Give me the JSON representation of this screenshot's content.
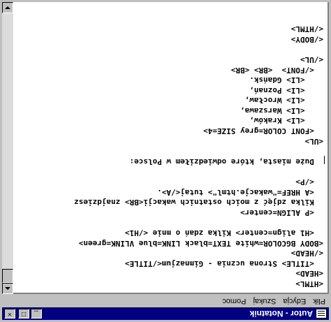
{
  "window": {
    "title": "Autor - Notatnik",
    "minimize_label": "_",
    "maximize_label": "□",
    "close_label": "×"
  },
  "menu": {
    "items": [
      "Plik",
      "Edycja",
      "Szukaj",
      "Pomoc"
    ]
  },
  "editor": {
    "lines": [
      "<HTML>",
      "<HEAD>",
      "  <TITLE> Strona ucznia - Gimnazjum</TITLE>",
      "</HEAD>",
      "<BODY BGCOLOR=white TEXT=black LINK=blue VLINK=green>",
      "  <H1 align=center> Kilka zdań o mnie </H1>",
      "",
      "  <P ALIGN=center>",
      "  Kilka zdjęć z moich ostatnich wakacji<BR> znajdziesz",
      "  <A HREF=\"wakacje.html\"> tutaj</A>.",
      "  </P>",
      "",
      "  Duże miasta, które odwiedziłem w Polsce:",
      "",
      "<UL>",
      "  <FONT COLOR=grey SIZE=4>",
      "    <LI> Kraków,",
      "    <LI> Warszawa,",
      "    <LI> Wrocław,",
      "    <LI> Poznań,",
      "    <LI> Gdańsk.",
      "  </FONT>  <BR> <BR>",
      "</UL>",
      "",
      "</BODY>",
      "</HTML>"
    ]
  },
  "colors": {
    "titlebar": "#000080",
    "chrome": "#c0c0c0",
    "editor_bg": "#ffffff",
    "text": "#000000"
  }
}
